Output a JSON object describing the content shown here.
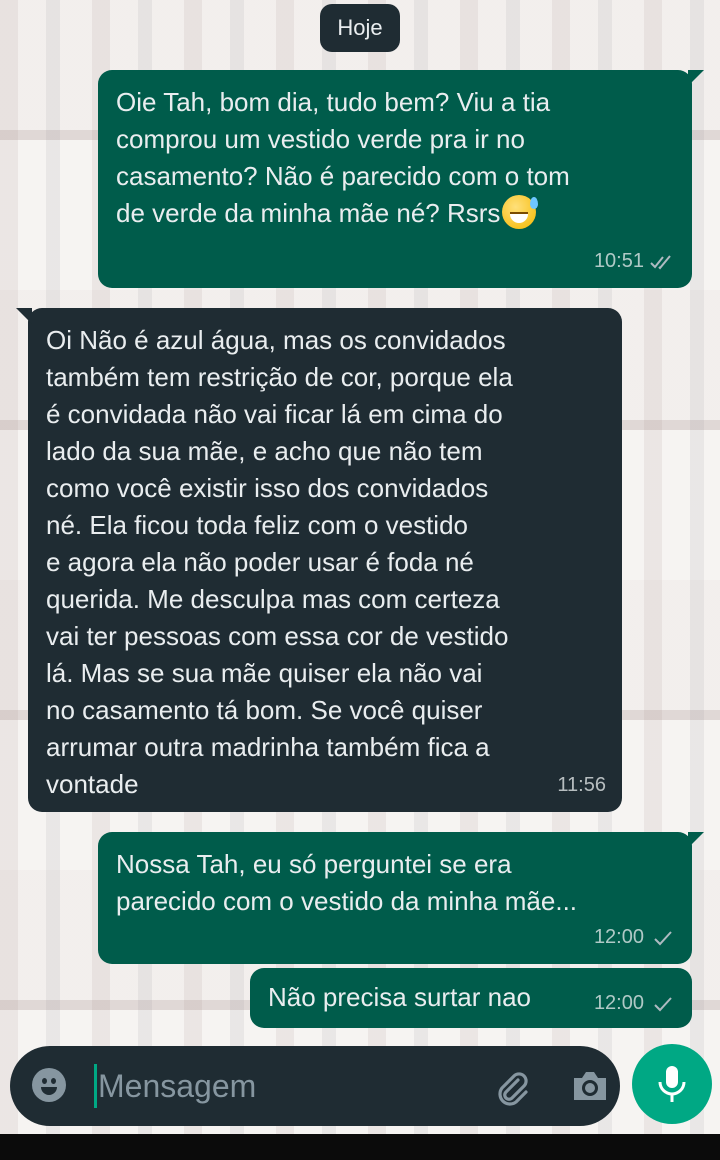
{
  "date_separator": "Hoje",
  "messages": [
    {
      "direction": "outgoing",
      "text": "Oie Tah, bom dia, tudo bem? Viu a tia\ncomprou um vestido verde pra ir no\ncasamento? Não é parecido com o tom\nde verde da minha mãe né? Rsrs",
      "emoji": "grinning-sweat-emoji",
      "time": "10:51",
      "status": "read"
    },
    {
      "direction": "incoming",
      "text": "Oi Não é  azul água, mas os convidados\ntambém tem restrição de cor, porque ela\né convidada não vai ficar lá em cima do\nlado da sua mãe, e acho que não tem\ncomo você existir isso dos convidados\nné. Ela ficou toda feliz com o vestido\ne agora ela não poder usar é foda né\nquerida. Me desculpa mas com certeza\nvai ter pessoas com essa cor de vestido\nlá. Mas se sua mãe quiser ela não vai\nno casamento tá bom. Se você quiser\narrumar outra madrinha também fica a\nvontade",
      "time": "11:56"
    },
    {
      "direction": "outgoing",
      "text": "Nossa Tah, eu só perguntei se era\nparecido com o vestido da minha mãe...",
      "time": "12:00",
      "status": "sent"
    },
    {
      "direction": "outgoing",
      "text": "Não precisa surtar nao",
      "time": "12:00",
      "status": "sent"
    }
  ],
  "composer": {
    "placeholder": "Mensagem",
    "icons": [
      "emoji-icon",
      "attach-clip-icon",
      "camera-icon",
      "microphone-icon"
    ]
  },
  "colors": {
    "outgoing_bubble": "#005c4b",
    "incoming_bubble": "#1f2c33",
    "accent": "#00a884",
    "text": "#e9edef"
  }
}
